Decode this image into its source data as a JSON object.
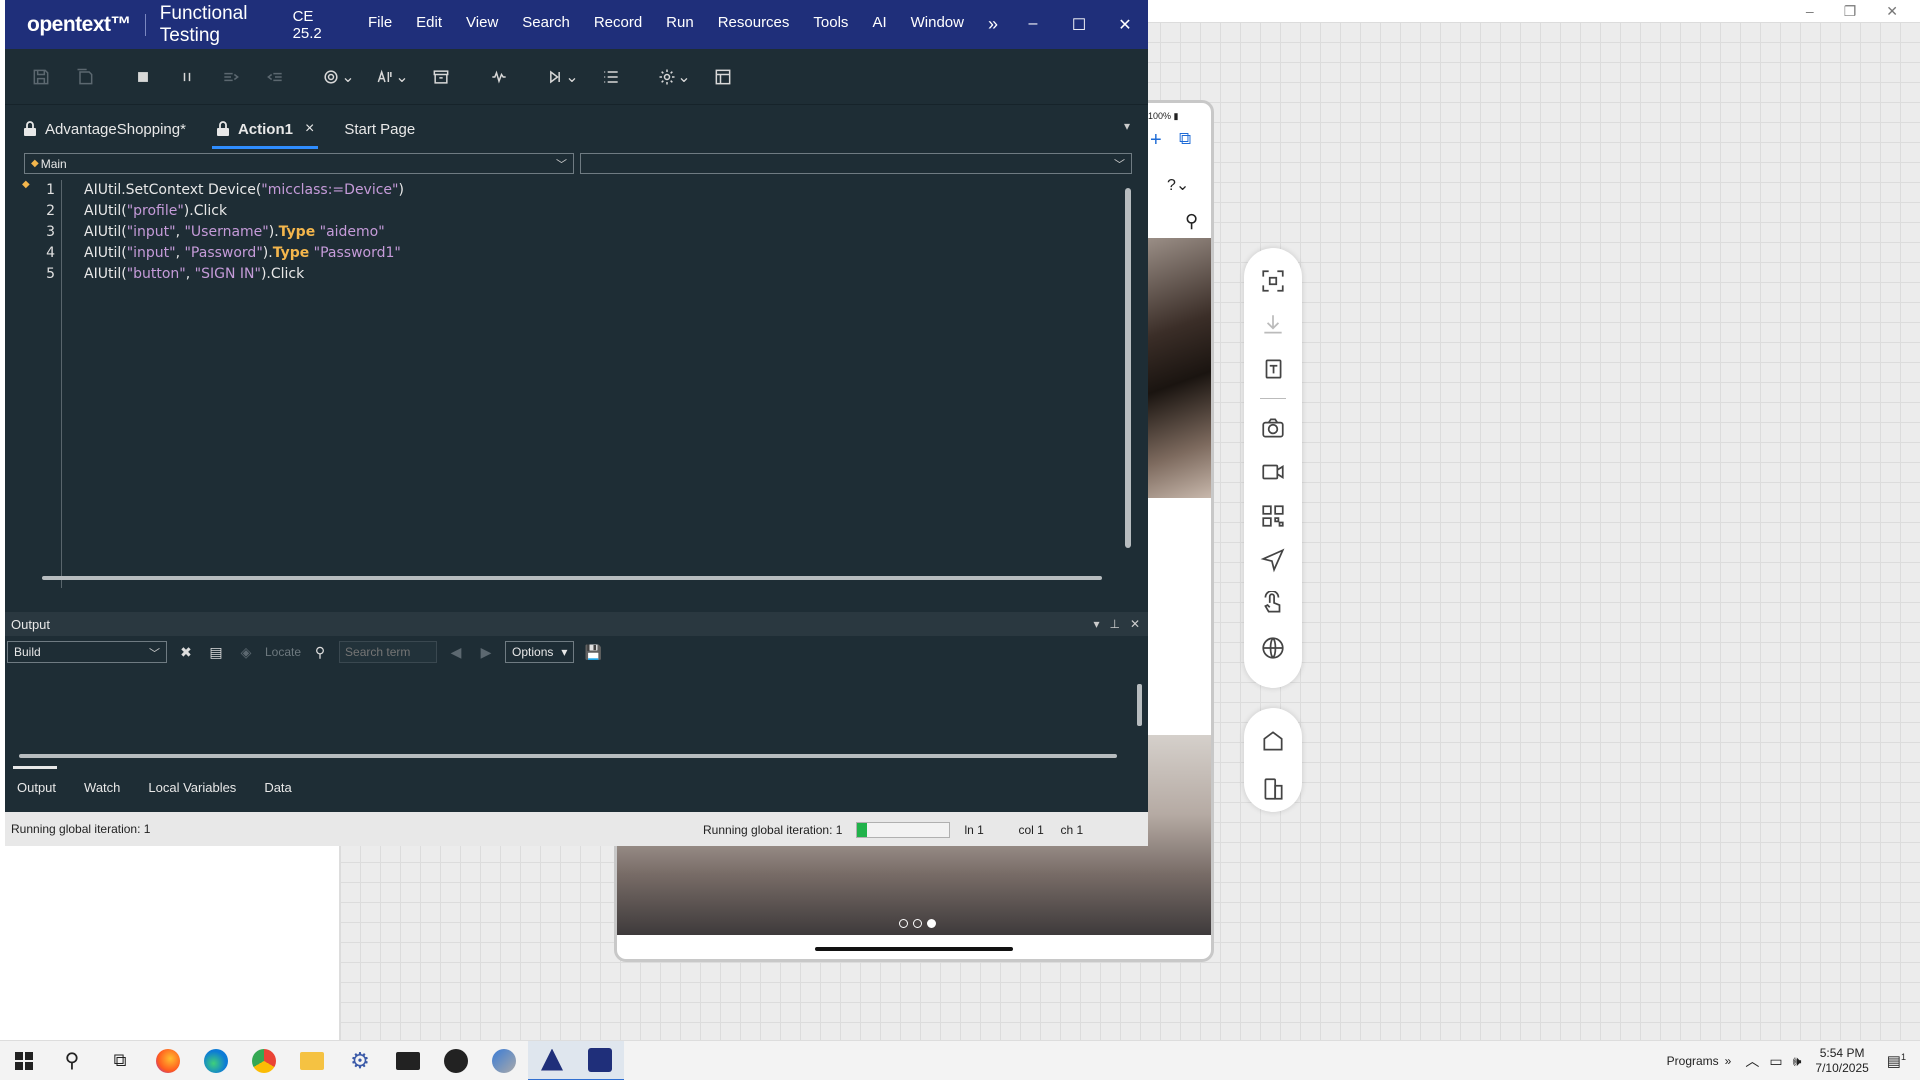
{
  "background_window": {
    "controls": [
      "–",
      "❐",
      "✕"
    ]
  },
  "device": {
    "status": "100%",
    "carousel": {
      "slides": 3,
      "active": 3
    }
  },
  "side_tools": {
    "icons": [
      "fullscreen-icon",
      "download-icon",
      "clipboard-text-icon",
      "camera-icon",
      "video-icon",
      "qr-code-icon",
      "send-icon",
      "touch-icon",
      "globe-icon",
      "home-icon",
      "rotate-icon"
    ]
  },
  "window": {
    "logo": "opentext™",
    "title": "Functional Testing",
    "version": "CE 25.2",
    "menu": [
      "File",
      "Edit",
      "View",
      "Search",
      "Record",
      "Run",
      "Resources",
      "Tools",
      "AI",
      "Window"
    ],
    "more": "»",
    "controls": {
      "minimize": "–",
      "maximize": "☐",
      "close": "✕"
    }
  },
  "tabs": [
    {
      "label": "AdvantageShopping*",
      "locked": true
    },
    {
      "label": "Action1",
      "locked": true,
      "active": true,
      "close": "×"
    },
    {
      "label": "Start Page"
    }
  ],
  "editor": {
    "scope_dropdown": "Main",
    "member_dropdown": "",
    "line_numbers": [
      "1",
      "2",
      "3",
      "4",
      "5"
    ]
  },
  "output": {
    "header": "Output",
    "source_select": "Build",
    "locate": "Locate",
    "search_placeholder": "Search term",
    "options": "Options"
  },
  "bottom_tabs": [
    "Output",
    "Watch",
    "Local Variables",
    "Data"
  ],
  "status": {
    "left": "Running global iteration: 1",
    "right": "Running global iteration: 1",
    "progress": 0.1,
    "ln": "ln 1",
    "col": "col 1",
    "ch": "ch 1"
  },
  "taskbar": {
    "programs": "Programs",
    "more": "»",
    "time": "5:54 PM",
    "date": "7/10/2025",
    "notification": "1"
  },
  "colors": {
    "title_bar": "#1f2f7a",
    "editor_bg": "#1e2d35",
    "accent": "#2f8dff",
    "keyword": "#f4b64c",
    "string": "#c59bd9",
    "progress": "#20b24a"
  }
}
